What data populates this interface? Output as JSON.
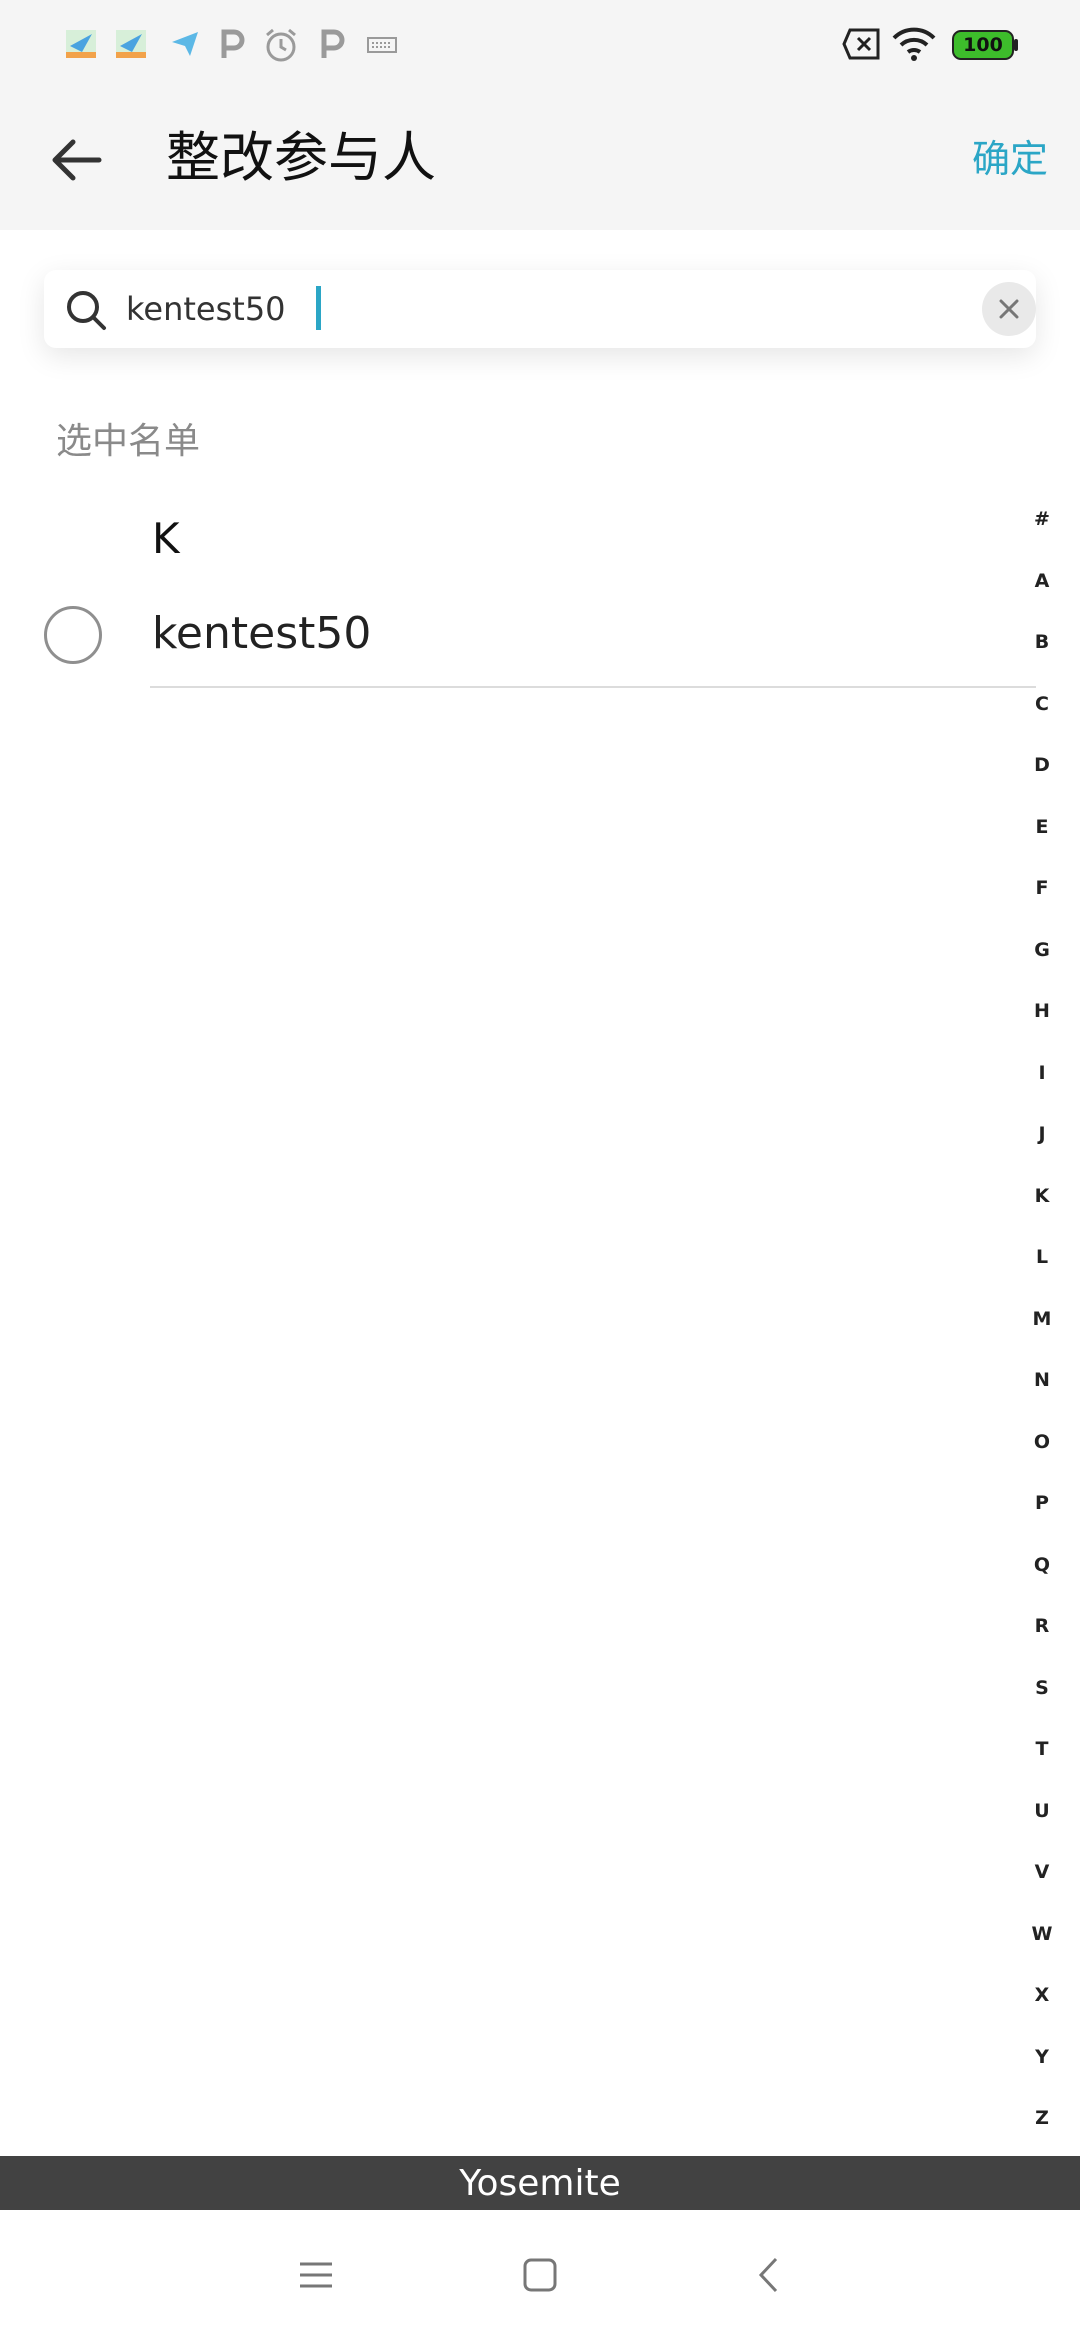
{
  "status_bar": {
    "battery_level": "100",
    "icons": [
      "app-icon",
      "app-icon",
      "paper-plane-icon",
      "p-icon",
      "alarm-icon",
      "p-icon",
      "keyboard-icon",
      "sim-off-icon",
      "wifi-icon",
      "battery-icon"
    ]
  },
  "header": {
    "title": "整改参与人",
    "confirm_label": "确定"
  },
  "search": {
    "value": "kentest50",
    "placeholder": ""
  },
  "section_label": "选中名单",
  "groups": [
    {
      "letter": "K",
      "items": [
        {
          "name": "kentest50",
          "selected": false
        }
      ]
    }
  ],
  "alphabet_index": [
    "#",
    "A",
    "B",
    "C",
    "D",
    "E",
    "F",
    "G",
    "H",
    "I",
    "J",
    "K",
    "L",
    "M",
    "N",
    "O",
    "P",
    "Q",
    "R",
    "S",
    "T",
    "U",
    "V",
    "W",
    "X",
    "Y",
    "Z"
  ],
  "banner_text": "Yosemite",
  "colors": {
    "accent": "#2ba6c6",
    "header_bg": "#f5f5f5",
    "banner_bg": "#424242",
    "battery_green": "#3dbd2b"
  }
}
